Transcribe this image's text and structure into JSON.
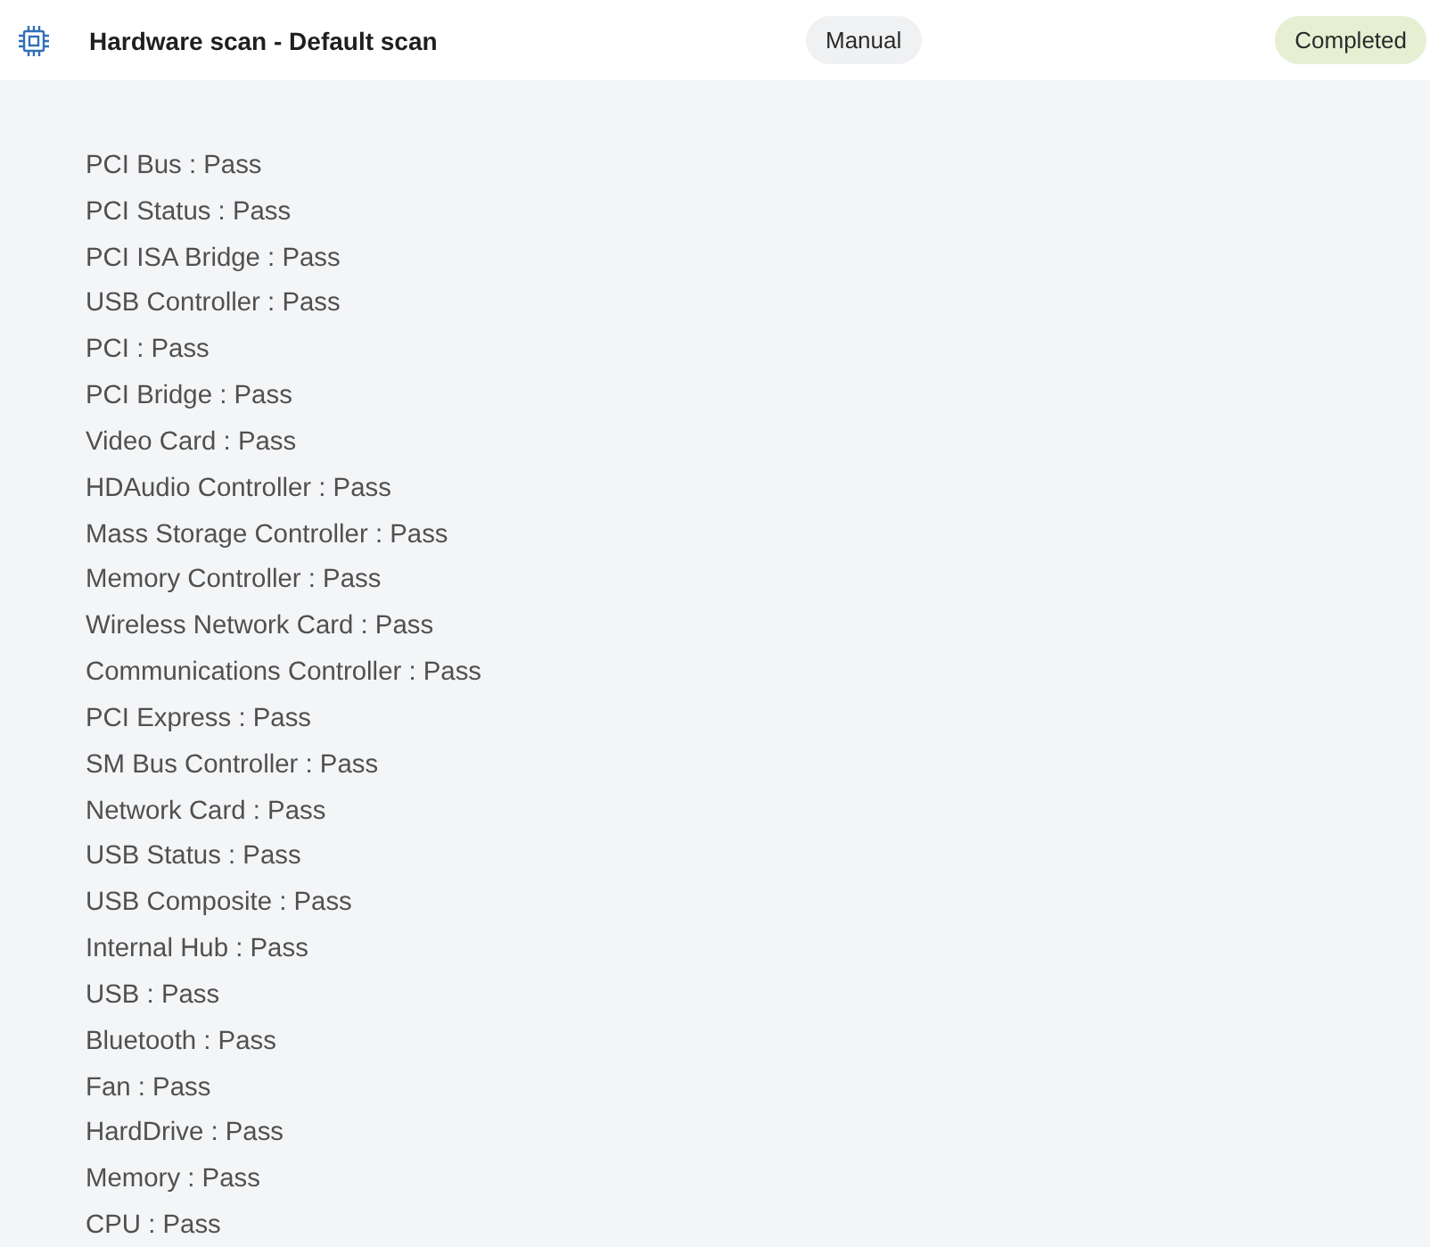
{
  "header": {
    "title": "Hardware scan - Default scan",
    "mode": "Manual",
    "status": "Completed"
  },
  "results": [
    "PCI Bus : Pass",
    "PCI Status : Pass",
    "PCI ISA Bridge : Pass",
    "USB Controller : Pass",
    "PCI : Pass",
    "PCI Bridge : Pass",
    "Video Card : Pass",
    "HDAudio Controller : Pass",
    "Mass Storage Controller : Pass",
    "Memory Controller : Pass",
    "Wireless Network Card : Pass",
    "Communications Controller : Pass",
    "PCI Express : Pass",
    "SM Bus Controller : Pass",
    "Network Card : Pass",
    "USB Status : Pass",
    "USB Composite : Pass",
    "Internal Hub : Pass",
    "USB : Pass",
    "Bluetooth : Pass",
    "Fan : Pass",
    "HardDrive : Pass",
    "Memory : Pass",
    "CPU : Pass"
  ]
}
